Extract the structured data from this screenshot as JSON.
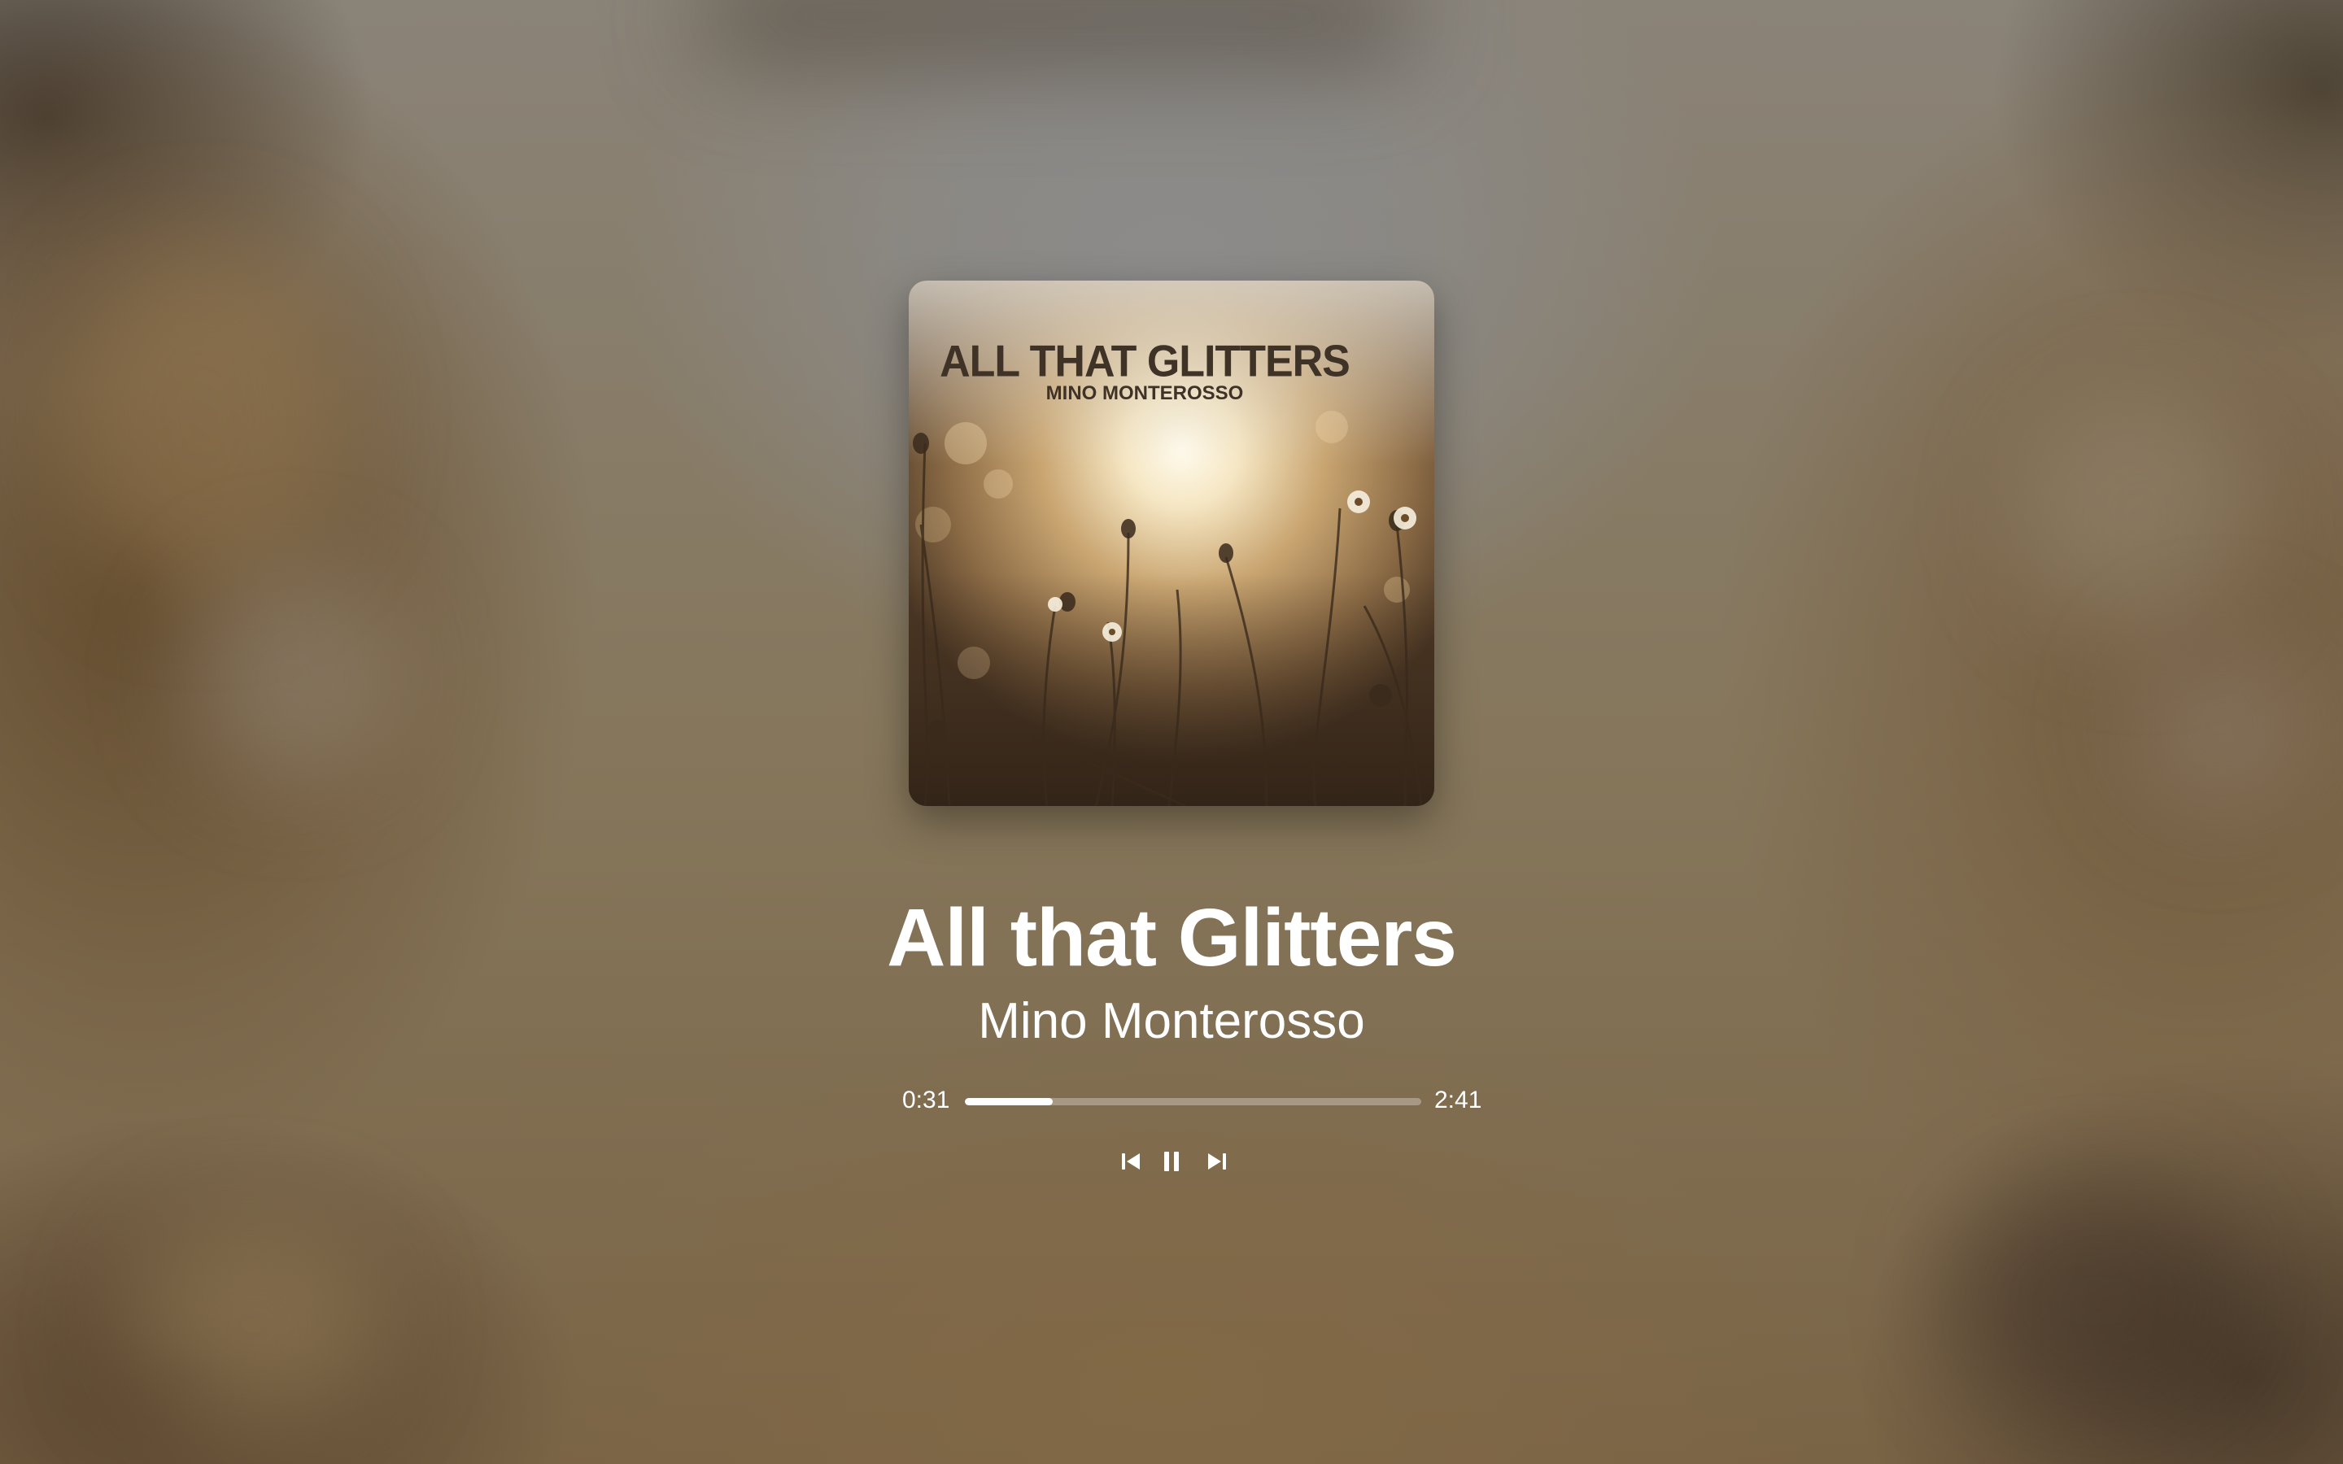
{
  "track": {
    "title": "All that Glitters",
    "artist": "Mino Monterosso"
  },
  "album_art": {
    "title_text": "ALL THAT GLITTERS",
    "artist_text": "MINO MONTEROSSO"
  },
  "playback": {
    "elapsed": "0:31",
    "duration": "2:41",
    "progress_fraction": 0.193
  },
  "controls": {
    "previous_icon": "skip-previous-icon",
    "pause_icon": "pause-icon",
    "next_icon": "skip-next-icon"
  },
  "colors": {
    "text": "#ffffff",
    "progress_track": "rgba(255,255,255,0.3)",
    "progress_fill": "#ffffff"
  }
}
